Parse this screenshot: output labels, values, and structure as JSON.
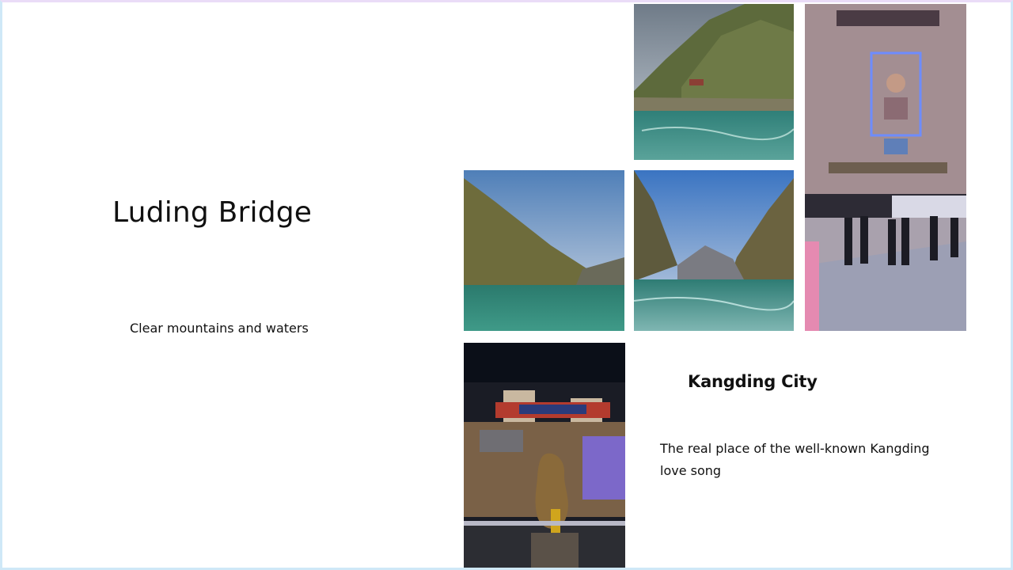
{
  "slide": {
    "luding": {
      "title": "Luding Bridge",
      "caption": "Clear mountains and  waters"
    },
    "kangding": {
      "title": "Kangding City",
      "caption": "The real place of the well-known Kangding love song"
    }
  },
  "colors": {
    "frame_border": "#cfe8f7",
    "text": "#111111",
    "river": "#3f8f86",
    "sky": "#8fb8da",
    "night": "#0b0f18"
  },
  "icons": []
}
